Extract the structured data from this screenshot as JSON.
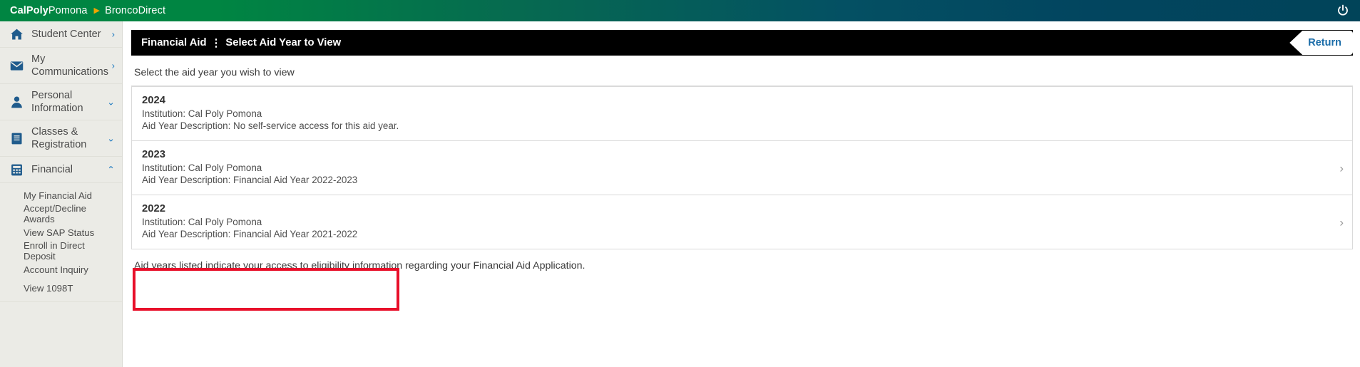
{
  "header": {
    "brand_bold": "CalPoly",
    "brand_rest": "Pomona",
    "separator": "▶",
    "app_name": "BroncoDirect",
    "power_icon": "power-icon"
  },
  "sidebar": {
    "items": [
      {
        "label": "Student Center",
        "icon": "home-icon",
        "chevron": "›",
        "name": "student-center"
      },
      {
        "label": "My Communications",
        "icon": "envelope-icon",
        "chevron": "›",
        "name": "my-communications"
      },
      {
        "label": "Personal Information",
        "icon": "person-icon",
        "chevron": "⌄",
        "name": "personal-information"
      },
      {
        "label": "Classes & Registration",
        "icon": "book-icon",
        "chevron": "⌄",
        "name": "classes-registration"
      },
      {
        "label": "Financial",
        "icon": "calculator-icon",
        "chevron": "⌃",
        "name": "financial"
      }
    ],
    "financial_subitems": [
      {
        "label": "My Financial Aid",
        "name": "my-financial-aid"
      },
      {
        "label": "Accept/Decline Awards",
        "name": "accept-decline-awards"
      },
      {
        "label": "View SAP Status",
        "name": "view-sap-status"
      },
      {
        "label": "Enroll in Direct Deposit",
        "name": "enroll-direct-deposit"
      },
      {
        "label": "Account Inquiry",
        "name": "account-inquiry"
      },
      {
        "label": "View 1098T",
        "name": "view-1098t"
      }
    ]
  },
  "page": {
    "title_primary": "Financial Aid",
    "title_separator": "⋮",
    "title_secondary": "Select Aid Year to View",
    "return_label": "Return",
    "subtitle": "Select the aid year you wish to view",
    "footnote": "Aid years listed indicate your access to eligibility information regarding your Financial Aid Application.",
    "chevron_glyph": "›"
  },
  "aid_years": [
    {
      "year": "2024",
      "institution": "Institution: Cal Poly Pomona",
      "description": "Aid Year Description: No self-service access for this aid year.",
      "has_chevron": false,
      "highlighted": false
    },
    {
      "year": "2023",
      "institution": "Institution: Cal Poly Pomona",
      "description": "Aid Year Description: Financial Aid Year 2022-2023",
      "has_chevron": true,
      "highlighted": true
    },
    {
      "year": "2022",
      "institution": "Institution: Cal Poly Pomona",
      "description": "Aid Year Description: Financial Aid Year 2021-2022",
      "has_chevron": true,
      "highlighted": false
    }
  ],
  "colors": {
    "brand_green": "#008542",
    "brand_teal": "#014459",
    "accent_blue": "#1a6ca8",
    "highlight_red": "#e8102a",
    "sidebar_bg": "#ebebe6"
  }
}
